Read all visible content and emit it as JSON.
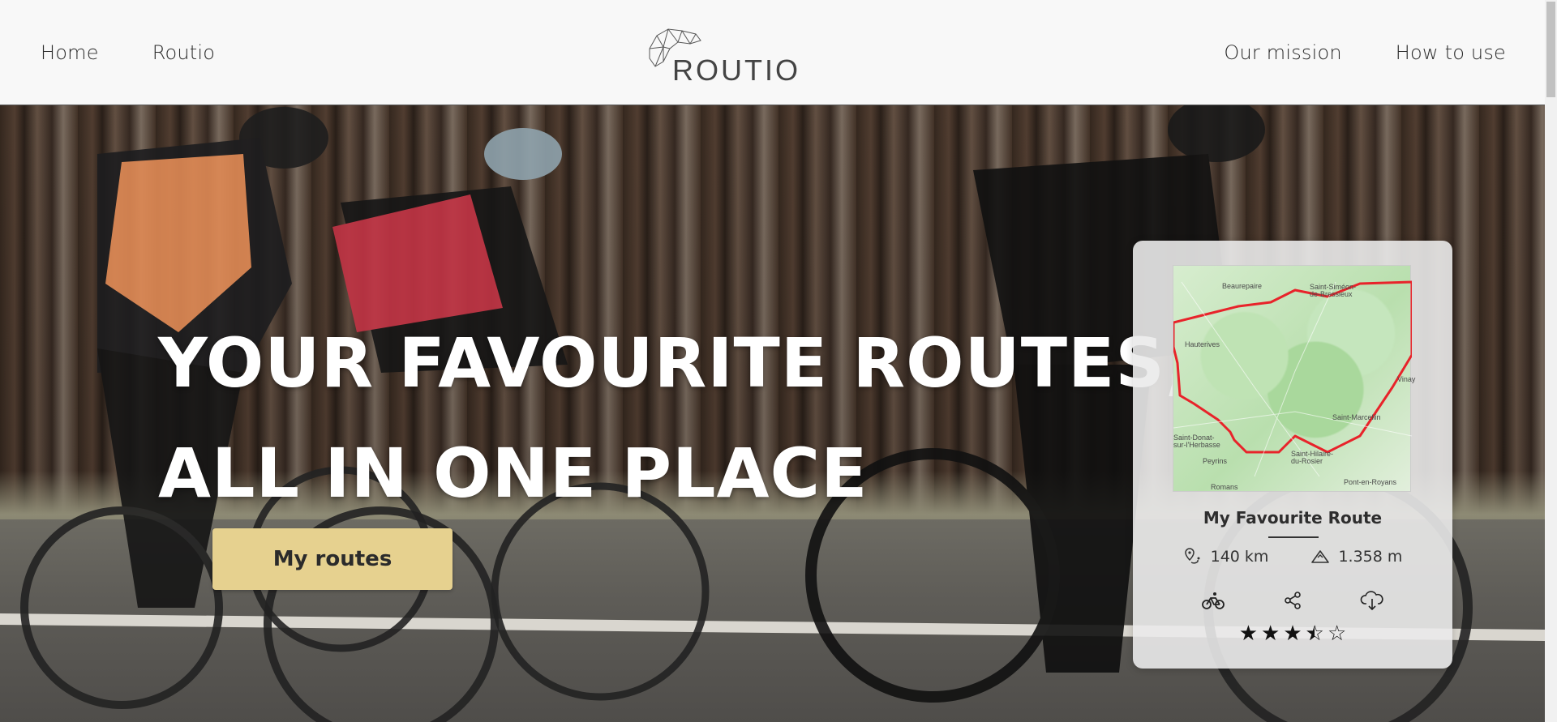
{
  "nav": {
    "left": [
      {
        "label": "Home"
      },
      {
        "label": "Routio"
      }
    ],
    "brand": "ROUTIO",
    "right": [
      {
        "label": "Our mission"
      },
      {
        "label": "How to use"
      }
    ]
  },
  "hero": {
    "headline_line1": "YOUR FAVOURITE ROUTES,",
    "headline_line2": "ALL IN ONE PLACE",
    "cta_label": "My routes"
  },
  "route_card": {
    "title": "My Favourite Route",
    "distance": "140 km",
    "elevation": "1.358 m",
    "rating": 3.5,
    "rating_max": 5,
    "map_labels": [
      {
        "text": "Beaurepaire"
      },
      {
        "text": "Saint-Siméon-de-Bressieux"
      },
      {
        "text": "Saint-Marcellin"
      },
      {
        "text": "Hauterives"
      },
      {
        "text": "Saint-Donat-sur-l'Herbasse"
      },
      {
        "text": "Saint-Hilaire-du-Rosier"
      },
      {
        "text": "Pont-en-Royans"
      },
      {
        "text": "Romans"
      },
      {
        "text": "Vinay"
      },
      {
        "text": "Peyrins"
      }
    ],
    "icons": {
      "distance": "route-pin-icon",
      "elevation": "mountain-icon",
      "bike": "bicycle-icon",
      "share": "share-icon",
      "download": "cloud-download-icon"
    },
    "accent_color": "#e8232a"
  },
  "colors": {
    "cta_bg": "#e6d18f",
    "nav_bg": "#f8f8f8"
  }
}
